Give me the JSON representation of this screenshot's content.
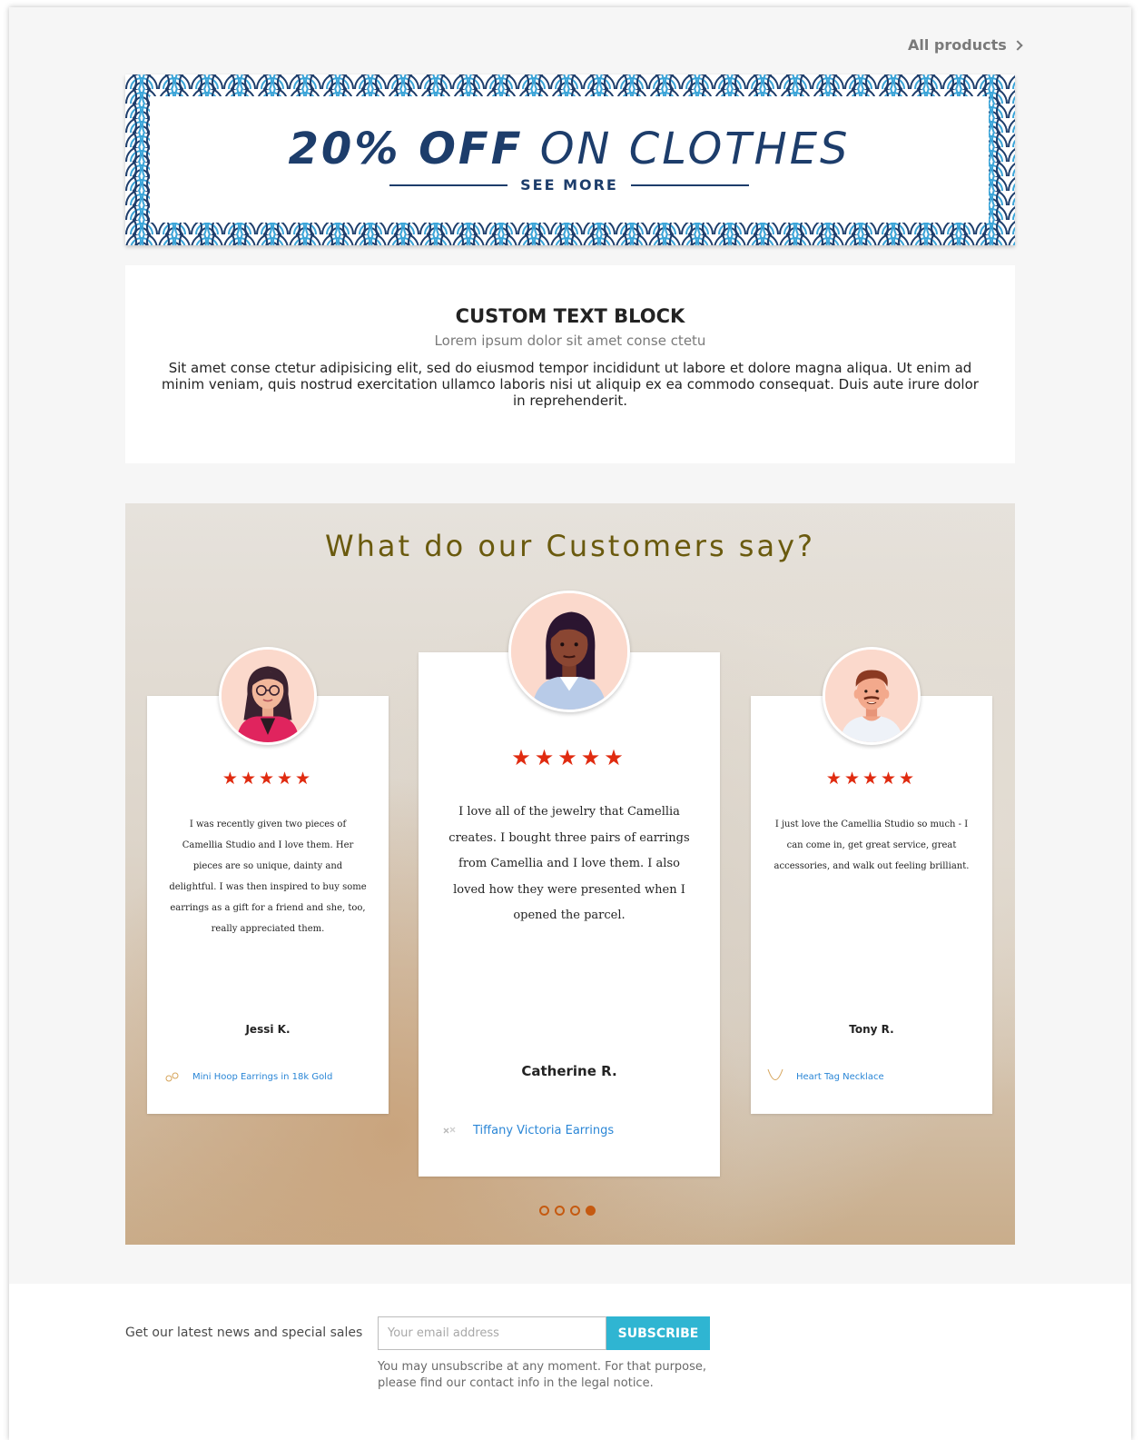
{
  "header": {
    "all_products_label": "All products"
  },
  "banner": {
    "title_bold": "20% OFF",
    "title_light": "ON CLOTHES",
    "cta_label": "SEE MORE",
    "colors": {
      "navy": "#1d3d6b",
      "pattern_blue": "#3aa4d8"
    }
  },
  "text_block": {
    "title": "CUSTOM TEXT BLOCK",
    "subtitle": "Lorem ipsum dolor sit amet conse ctetu",
    "body": "Sit amet conse ctetur adipisicing elit, sed do eiusmod tempor incididunt ut labore et dolore magna aliqua. Ut enim ad minim veniam, quis nostrud exercitation ullamco laboris nisi ut aliquip ex ea commodo consequat. Duis aute irure dolor in reprehenderit."
  },
  "testimonials": {
    "heading": "What do our Customers say?",
    "cards": [
      {
        "rating": 5,
        "stars": "★★★★★",
        "quote": "I was recently given two pieces of Camellia Studio and I love them. Her pieces are so unique, dainty and delightful. I was then inspired to buy some earrings as a gift for a friend and she, too, really appreciated them.",
        "author": "Jessi K.",
        "product": "Mini Hoop Earrings in 18k Gold",
        "avatar_icon": "woman-glasses-avatar"
      },
      {
        "rating": 5,
        "stars": "★★★★★",
        "quote": "I love all of the jewelry that Camellia creates. I bought three pairs of earrings from Camellia and I love them. I also loved how they were presented when I opened the parcel.",
        "author": "Catherine R.",
        "product": "Tiffany Victoria Earrings",
        "avatar_icon": "woman-avatar"
      },
      {
        "rating": 5,
        "stars": "★★★★★",
        "quote": "I just love the Camellia Studio so much - I can come in, get great service, great accessories, and walk out feeling brilliant.",
        "author": "Tony R.",
        "product": "Heart Tag Necklace",
        "avatar_icon": "man-avatar"
      }
    ],
    "pagination": {
      "total": 4,
      "active_index": 3
    },
    "colors": {
      "heading": "#6a5a0e",
      "star": "#e02b10",
      "link": "#2a86d6",
      "dot": "#c55a11"
    }
  },
  "newsletter": {
    "label": "Get our latest news and special sales",
    "email_placeholder": "Your email address",
    "email_value": "",
    "subscribe_label": "SUBSCRIBE",
    "note": "You may unsubscribe at any moment. For that purpose, please find our contact info in the legal notice.",
    "colors": {
      "button": "#2fb5d2"
    }
  }
}
